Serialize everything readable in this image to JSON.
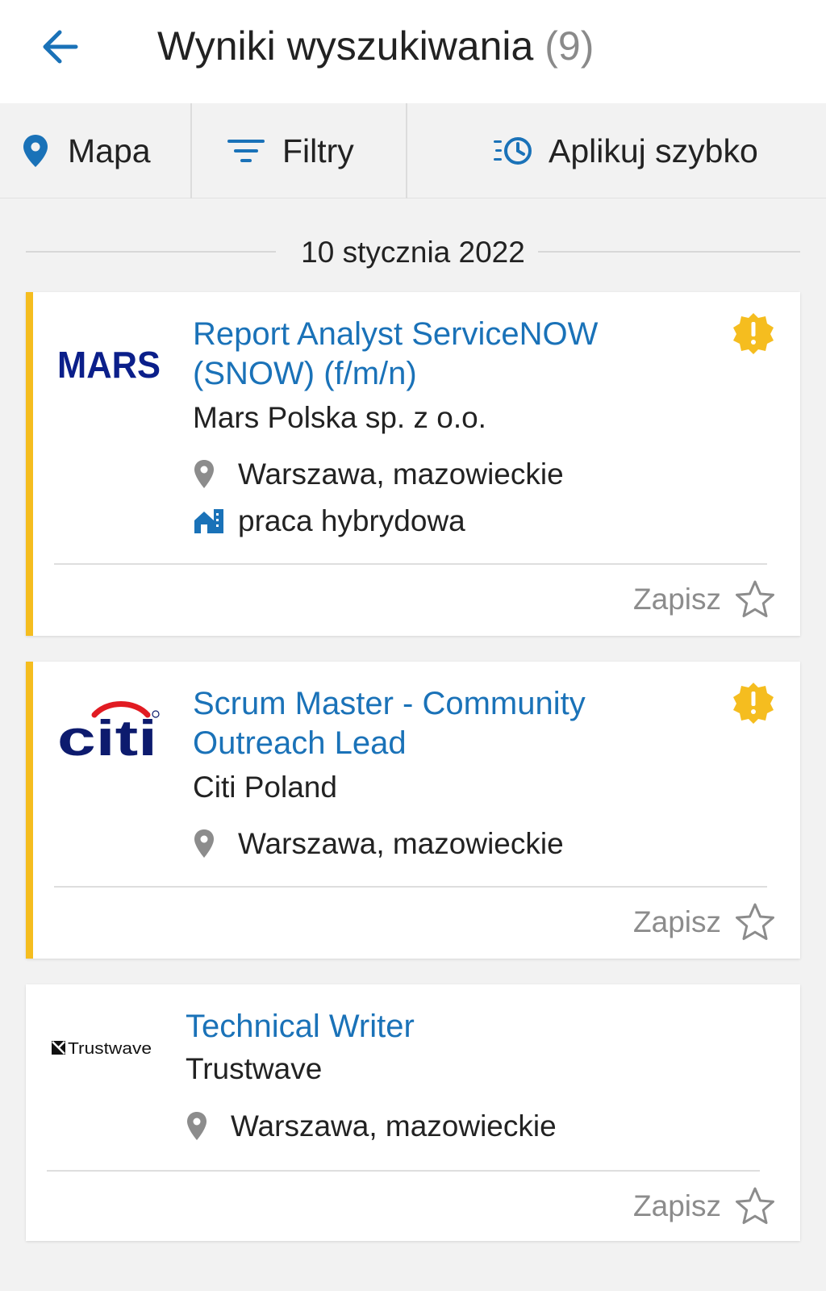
{
  "header": {
    "title": "Wyniki wyszukiwania",
    "count": "(9)"
  },
  "actions": {
    "map_label": "Mapa",
    "filters_label": "Filtry",
    "quick_apply_label": "Aplikuj szybko"
  },
  "date_separator": "10 stycznia 2022",
  "jobs": [
    {
      "title": "Report Analyst ServiceNOW (SNOW) (f/m/n)",
      "company": "Mars Polska sp. z o.o.",
      "logo_text": "MARS",
      "location": "Warszawa, mazowieckie",
      "work_mode": "praca hybrydowa",
      "promoted": true,
      "save_label": "Zapisz"
    },
    {
      "title": "Scrum Master - Community Outreach Lead",
      "company": "Citi Poland",
      "logo_text": "citi",
      "location": "Warszawa, mazowieckie",
      "promoted": true,
      "save_label": "Zapisz"
    },
    {
      "title": "Technical Writer",
      "company": "Trustwave",
      "logo_text": "Trustwave",
      "location": "Warszawa, mazowieckie",
      "promoted": false,
      "save_label": "Zapisz"
    }
  ],
  "colors": {
    "accent_blue": "#1a72b8",
    "promo_yellow": "#f5bd1f",
    "mars_navy": "#0b1f8a",
    "citi_navy": "#0d1b6e",
    "citi_red": "#e11b22"
  },
  "icons": {
    "back": "arrow-left-icon",
    "map": "map-pin-icon",
    "filters": "filter-lines-icon",
    "quick_apply": "fast-clock-icon",
    "location": "location-pin-icon",
    "work_mode": "hybrid-building-icon",
    "alert": "alert-badge-icon",
    "save": "star-outline-icon"
  }
}
